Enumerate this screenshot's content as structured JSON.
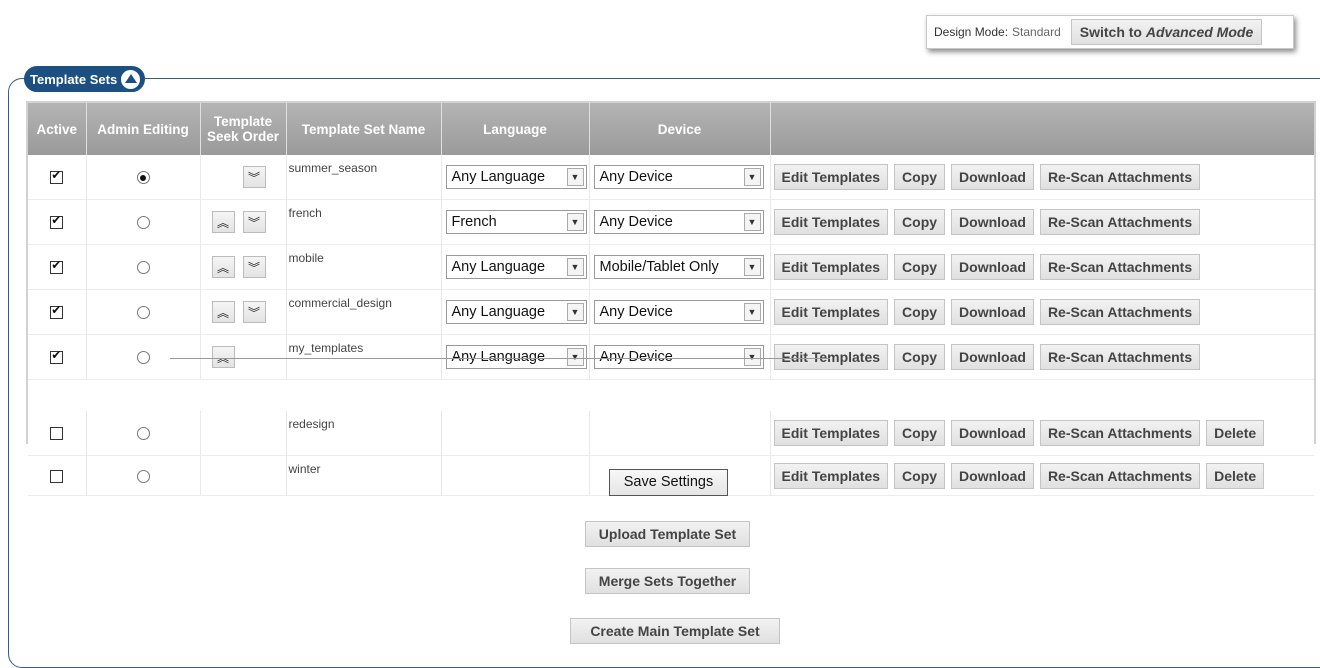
{
  "design_mode": {
    "label": "Design Mode:",
    "value": "Standard",
    "switch_prefix": "Switch to ",
    "switch_emphasis": "Advanced Mode"
  },
  "panel": {
    "title": "Template Sets"
  },
  "table": {
    "headers": {
      "active": "Active",
      "admin_editing": "Admin Editing",
      "seek_order_line1": "Template",
      "seek_order_line2": "Seek Order",
      "name": "Template Set Name",
      "language": "Language",
      "device": "Device"
    },
    "buttons": {
      "edit": "Edit Templates",
      "copy": "Copy",
      "download": "Download",
      "rescan": "Re-Scan Attachments",
      "delete": "Delete"
    },
    "rows": [
      {
        "name": "summer_season",
        "active": true,
        "admin": true,
        "up": false,
        "down": true,
        "language": "Any Language",
        "device": "Any Device",
        "deletable": false
      },
      {
        "name": "french",
        "active": true,
        "admin": false,
        "up": true,
        "down": true,
        "language": "French",
        "device": "Any Device",
        "deletable": false
      },
      {
        "name": "mobile",
        "active": true,
        "admin": false,
        "up": true,
        "down": true,
        "language": "Any Language",
        "device": "Mobile/Tablet Only",
        "deletable": false
      },
      {
        "name": "commercial_design",
        "active": true,
        "admin": false,
        "up": true,
        "down": true,
        "language": "Any Language",
        "device": "Any Device",
        "deletable": false
      },
      {
        "name": "my_templates",
        "active": true,
        "admin": false,
        "up": true,
        "down": false,
        "language": "Any Language",
        "device": "Any Device",
        "deletable": false
      }
    ],
    "inactive_rows": [
      {
        "name": "redesign",
        "active": false,
        "admin": false,
        "deletable": true
      },
      {
        "name": "winter",
        "active": false,
        "admin": false,
        "deletable": true
      }
    ]
  },
  "bottom": {
    "save": "Save Settings",
    "upload": "Upload Template Set",
    "merge": "Merge Sets Together",
    "create": "Create Main Template Set"
  },
  "colors": {
    "frame": "#2f5f8c",
    "legend": "#1d5082",
    "header": "#a7a7a7"
  }
}
